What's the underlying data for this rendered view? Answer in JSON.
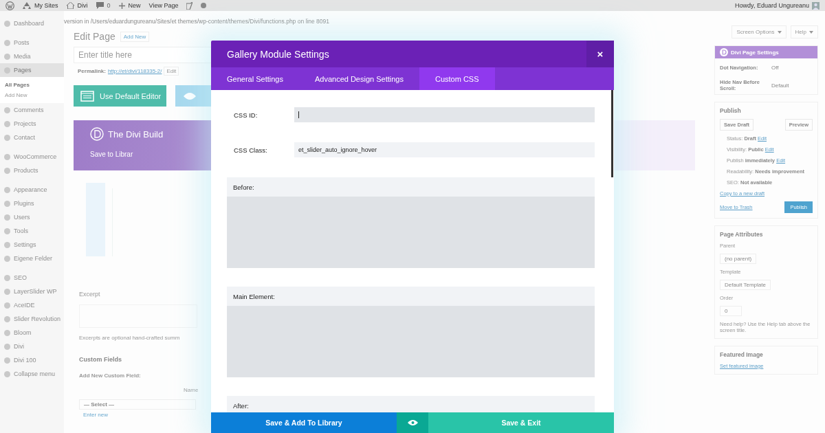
{
  "admin_bar": {
    "items": [
      {
        "kind": "wp_logo"
      },
      {
        "kind": "sites",
        "label": "My Sites"
      },
      {
        "kind": "home",
        "label": "Divi"
      },
      {
        "kind": "comments",
        "label": "0"
      },
      {
        "kind": "new",
        "label": "New"
      },
      {
        "kind": "text",
        "label": "View Page"
      },
      {
        "kind": "yoast"
      },
      {
        "kind": "status_dot"
      }
    ],
    "greeting": "Howdy, Eduard Ungureanu"
  },
  "notice": "version in /Users/eduardungureanu/Sites/et themes/wp-content/themes/Divi/functions.php on line 8091",
  "sidebar": {
    "groups": [
      [
        {
          "label": "Dashboard",
          "selected": false
        }
      ],
      [
        {
          "label": "Posts",
          "selected": false
        },
        {
          "label": "Media",
          "selected": false
        },
        {
          "label": "Pages",
          "selected": true,
          "children": [
            {
              "label": "All Pages",
              "selected": true
            },
            {
              "label": "Add New",
              "selected": false
            }
          ]
        },
        {
          "label": "Comments",
          "selected": false
        },
        {
          "label": "Projects",
          "selected": false
        },
        {
          "label": "Contact",
          "selected": false
        }
      ],
      [
        {
          "label": "WooCommerce",
          "selected": false
        },
        {
          "label": "Products",
          "selected": false
        }
      ],
      [
        {
          "label": "Appearance",
          "selected": false
        },
        {
          "label": "Plugins",
          "selected": false
        },
        {
          "label": "Users",
          "selected": false
        },
        {
          "label": "Tools",
          "selected": false
        },
        {
          "label": "Settings",
          "selected": false
        },
        {
          "label": "Eigene Felder",
          "selected": false
        }
      ],
      [
        {
          "label": "SEO",
          "selected": false
        },
        {
          "label": "LayerSlider WP",
          "selected": false
        },
        {
          "label": "AceIDE",
          "selected": false
        },
        {
          "label": "Slider Revolution",
          "selected": false
        },
        {
          "label": "Bloom",
          "selected": false
        },
        {
          "label": "Divi",
          "selected": false
        },
        {
          "label": "Divi 100",
          "selected": false
        },
        {
          "label": "Collapse menu",
          "selected": false
        }
      ]
    ]
  },
  "editor": {
    "heading": "Edit Page",
    "add_new": "Add New",
    "title_placeholder": "Enter title here",
    "permalink": {
      "label": "Permalink:",
      "url": "http://et/divi/118335-2/",
      "edit": "Edit"
    },
    "default_editor_button": "Use Default Editor",
    "builder": {
      "title": "The Divi Build",
      "save": "Save to Librar"
    },
    "excerpt": {
      "title": "Excerpt",
      "hint": "Excerpts are optional hand-crafted summ"
    },
    "custom_fields": {
      "title": "Custom Fields",
      "add_label": "Add New Custom Field:",
      "column": "Name",
      "select": "— Select —",
      "enter_new": "Enter new"
    }
  },
  "screen_options": "Screen Options",
  "help": "Help",
  "divi_settings": {
    "title": "Divi Page Settings",
    "fields": [
      {
        "label": "Dot Navigation:",
        "value": "Off"
      },
      {
        "label": "Hide Nav Before Scroll:",
        "value": "Default"
      }
    ]
  },
  "publish": {
    "title": "Publish",
    "save_draft": "Save Draft",
    "preview": "Preview",
    "rows": [
      {
        "label": "Status:",
        "value": "Draft",
        "edit": "Edit"
      },
      {
        "label": "Visibility:",
        "value": "Public",
        "edit": "Edit"
      },
      {
        "label": "Publish",
        "value": "immediately",
        "edit": "Edit"
      },
      {
        "label": "Readability:",
        "value": "Needs improvement"
      },
      {
        "label": "SEO:",
        "value": "Not available"
      }
    ],
    "copy": "Copy to a new draft",
    "trash": "Move to Trash",
    "publish_button": "Publish"
  },
  "page_attributes": {
    "title": "Page Attributes",
    "parent_label": "Parent",
    "parent": "(no parent)",
    "template_label": "Template",
    "template": "Default Template",
    "order_label": "Order",
    "order": "0",
    "help": "Need help? Use the Help tab above the screen title."
  },
  "featured_image": {
    "title": "Featured Image",
    "link": "Set featured image"
  },
  "modal": {
    "title": "Gallery Module Settings",
    "close": "×",
    "tabs": [
      {
        "label": "General Settings",
        "selected": false
      },
      {
        "label": "Advanced Design Settings",
        "selected": false
      },
      {
        "label": "Custom CSS",
        "selected": true
      }
    ],
    "fields": [
      {
        "label": "CSS ID:",
        "focused": true
      },
      {
        "label": "CSS Class:",
        "value": "et_slider_auto_ignore_hover",
        "focused": false
      }
    ],
    "sections": [
      {
        "label": "Before:"
      },
      {
        "label": "Main Element:"
      },
      {
        "label": "After:"
      }
    ],
    "footer": {
      "library": "Save & Add To Library",
      "exit": "Save & Exit"
    }
  }
}
